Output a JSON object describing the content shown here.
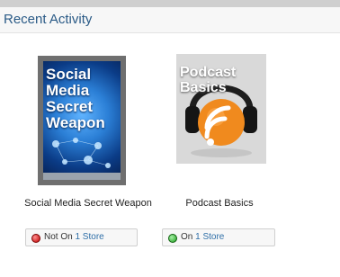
{
  "header": {
    "title": "Recent Activity"
  },
  "items": [
    {
      "cover_title": "Social Media Secret Weapon",
      "label": "Social Media Secret Weapon",
      "store_status": {
        "prefix": "Not On",
        "link": "1 Store",
        "status": "red"
      }
    },
    {
      "cover_title": "Podcast Basics",
      "label": "Podcast Basics",
      "store_status": {
        "prefix": "On",
        "link": "1 Store",
        "status": "green"
      }
    }
  ]
}
